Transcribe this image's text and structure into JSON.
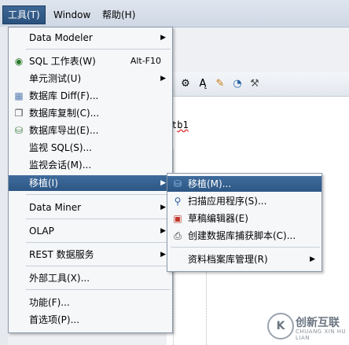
{
  "menubar": {
    "items": [
      {
        "label": "工具(T)",
        "active": true
      },
      {
        "label": "Window"
      },
      {
        "label": "帮助(H)"
      }
    ]
  },
  "editor": {
    "text_prefix": "t",
    "text_squiggle": "b1"
  },
  "tools_menu": {
    "items": [
      {
        "label": "Data Modeler",
        "submenu": true
      },
      {
        "label": "SQL 工作表(W)",
        "shortcut": "Alt-F10",
        "icon": "sql-worksheet-icon"
      },
      {
        "label": "单元测试(U)",
        "submenu": true
      },
      {
        "label": "数据库 Diff(F)...",
        "icon": "database-diff-icon"
      },
      {
        "label": "数据库复制(C)...",
        "icon": "database-copy-icon"
      },
      {
        "label": "数据库导出(E)...",
        "icon": "database-export-icon"
      },
      {
        "label": "监视 SQL(S)..."
      },
      {
        "label": "监视会话(M)..."
      },
      {
        "label": "移植(I)",
        "submenu": true,
        "highlighted": true
      },
      {
        "label": "Data Miner",
        "submenu": true
      },
      {
        "label": "OLAP",
        "submenu": true
      },
      {
        "label": "REST 数据服务",
        "submenu": true
      },
      {
        "label": "外部工具(X)..."
      },
      {
        "label": "功能(F)..."
      },
      {
        "label": "首选项(P)..."
      }
    ]
  },
  "migration_submenu": {
    "items": [
      {
        "label": "移植(M)...",
        "highlighted": true,
        "icon": "migrate-icon"
      },
      {
        "label": "扫描应用程序(S)...",
        "icon": "scan-icon"
      },
      {
        "label": "草稿编辑器(E)",
        "icon": "scratch-editor-icon"
      },
      {
        "label": "创建数据库捕获脚本(C)...",
        "icon": "capture-script-icon"
      },
      {
        "label": "资料档案库管理(R)",
        "submenu": true
      }
    ]
  },
  "watermark": {
    "logo": "K",
    "text": "创新互联",
    "sub": "CHUANG XIN HU LIAN"
  }
}
